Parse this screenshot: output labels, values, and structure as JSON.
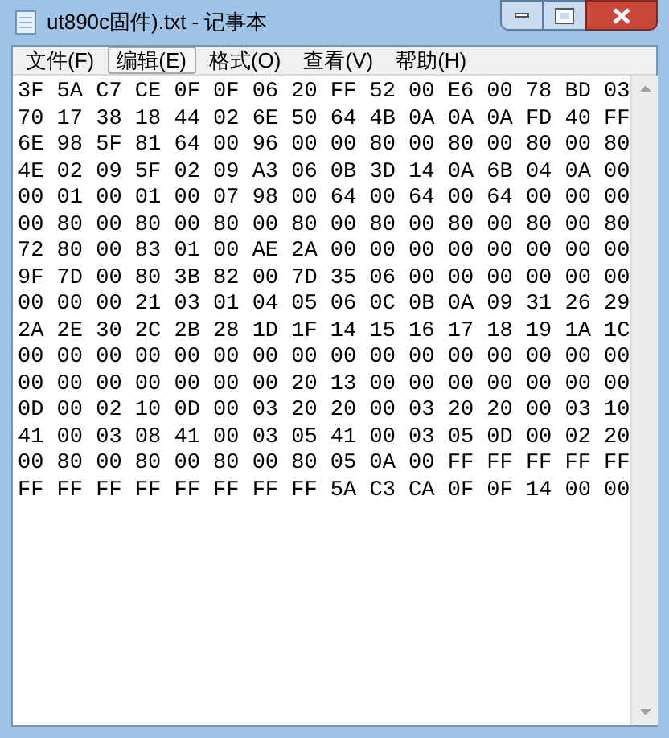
{
  "window": {
    "title": "ut890c固件).txt - 记事本"
  },
  "menu": [
    {
      "label": "文件(F)",
      "selected": false
    },
    {
      "label": "编辑(E)",
      "selected": true
    },
    {
      "label": "格式(O)",
      "selected": false
    },
    {
      "label": "查看(V)",
      "selected": false
    },
    {
      "label": "帮助(H)",
      "selected": false
    }
  ],
  "editor": {
    "lines": [
      "3F 5A C7 CE 0F 0F 06 20 FF 52 00 E6 00 78 BD 03",
      "70 17 38 18 44 02 6E 50 64 4B 0A 0A 0A FD 40 FF",
      "6E 98 5F 81 64 00 96 00 00 80 00 80 00 80 00 80",
      "4E 02 09 5F 02 09 A3 06 0B 3D 14 0A 6B 04 0A 00",
      "00 01 00 01 00 07 98 00 64 00 64 00 64 00 00 00",
      "00 80 00 80 00 80 00 80 00 80 00 80 00 80 00 80",
      "72 80 00 83 01 00 AE 2A 00 00 00 00 00 00 00 00",
      "9F 7D 00 80 3B 82 00 7D 35 06 00 00 00 00 00 00",
      "00 00 00 21 03 01 04 05 06 0C 0B 0A 09 31 26 29",
      "2A 2E 30 2C 2B 28 1D 1F 14 15 16 17 18 19 1A 1C",
      "00 00 00 00 00 00 00 00 00 00 00 00 00 00 00 00",
      "00 00 00 00 00 00 00 20 13 00 00 00 00 00 00 00",
      "0D 00 02 10 0D 00 03 20 20 00 03 20 20 00 03 10",
      "41 00 03 08 41 00 03 05 41 00 03 05 0D 00 02 20",
      "00 80 00 80 00 80 00 80 05 0A 00 FF FF FF FF FF",
      "FF FF FF FF FF FF FF FF 5A C3 CA 0F 0F 14 00 00"
    ]
  }
}
